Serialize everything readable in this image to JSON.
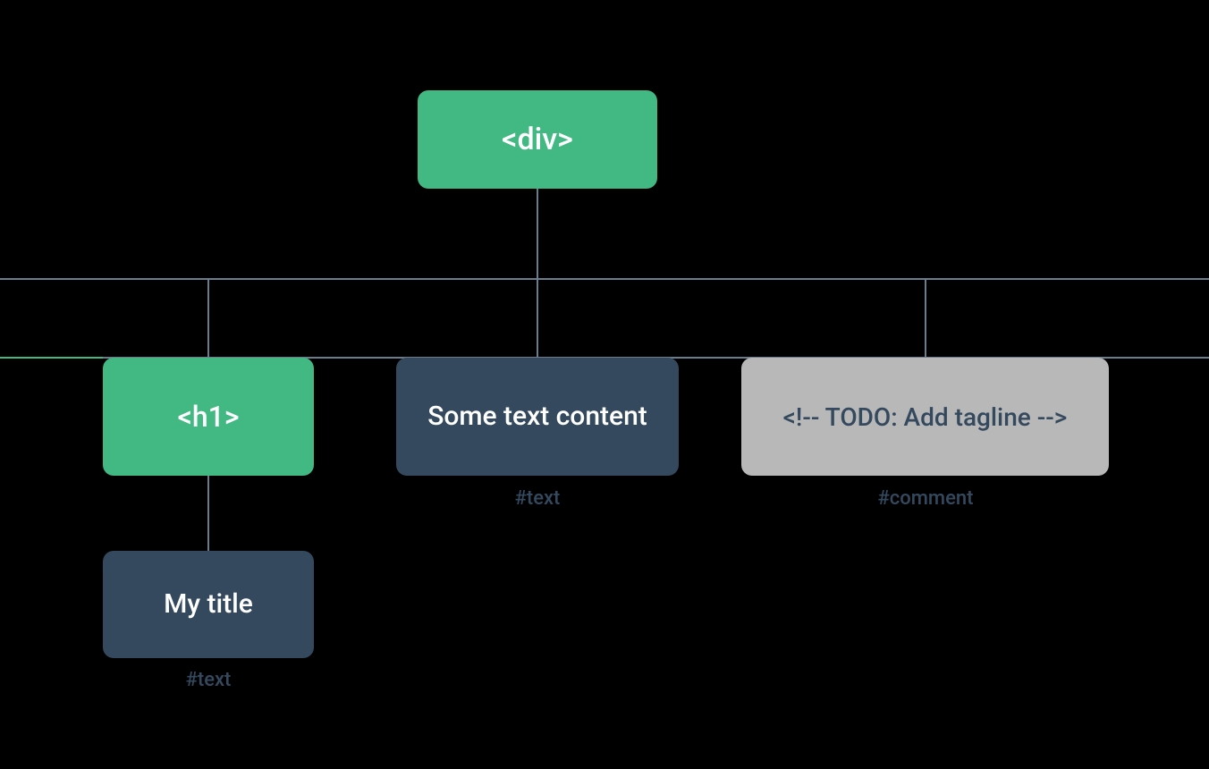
{
  "nodes": {
    "root": {
      "label": "<div>"
    },
    "h1": {
      "label": "<h1>"
    },
    "text2": {
      "label": "Some text content"
    },
    "comment": {
      "label": "<!-- TODO: Add tagline  -->"
    },
    "title": {
      "label": "My title"
    }
  },
  "captions": {
    "text2": "#text",
    "comment": "#comment",
    "title": "#text"
  },
  "colors": {
    "green": "#42b883",
    "navy": "#34495e",
    "grey": "#b8b8b8",
    "line": "#6b7c8c",
    "bg": "#000000"
  }
}
